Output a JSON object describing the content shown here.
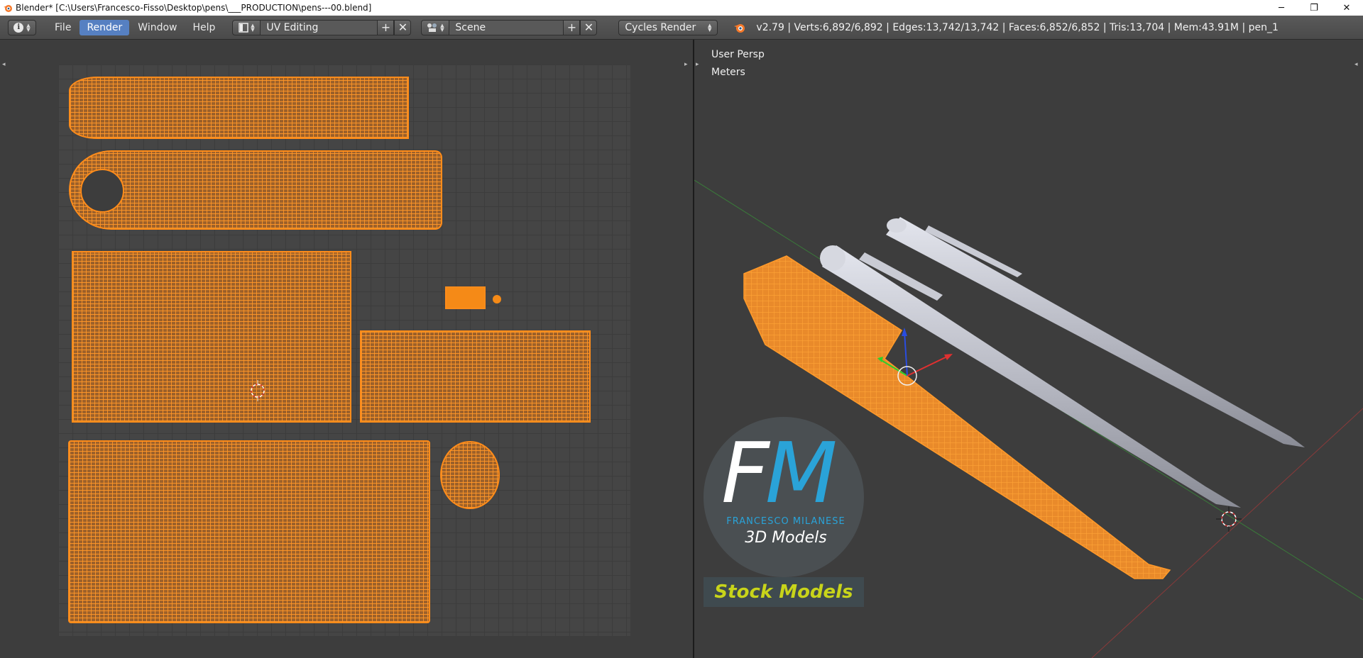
{
  "window": {
    "title": "Blender* [C:\\Users\\Francesco-Fisso\\Desktop\\pens\\___PRODUCTION\\pens---00.blend]",
    "controls": [
      "minimize",
      "restore",
      "close"
    ]
  },
  "infobar": {
    "menu": [
      {
        "label": "File",
        "active": false
      },
      {
        "label": "Render",
        "active": true
      },
      {
        "label": "Window",
        "active": false
      },
      {
        "label": "Help",
        "active": false
      }
    ],
    "screen_layout": "UV Editing",
    "scene": "Scene",
    "render_engine": "Cycles Render",
    "stats": "v2.79 | Verts:6,892/6,892 | Edges:13,742/13,742 | Faces:6,852/6,852 | Tris:13,704 | Mem:43.91M | pen_1"
  },
  "viewport": {
    "view_name": "User Persp",
    "units": "Meters"
  },
  "watermark": {
    "logo_f": "F",
    "logo_m": "M",
    "name": "FRANCESCO MILANESE",
    "subtitle": "3D Models",
    "badge": "Stock Models"
  },
  "colors": {
    "accent_orange": "#ff8c1a",
    "menu_active": "#5680c2",
    "logo_blue": "#2aa3d8",
    "badge_yellow": "#c8d41a"
  },
  "icons": [
    "blender-app-icon",
    "info-editor-icon",
    "screen-layout-icon",
    "scene-icon",
    "add-icon",
    "close-icon",
    "blender-logo-icon"
  ]
}
